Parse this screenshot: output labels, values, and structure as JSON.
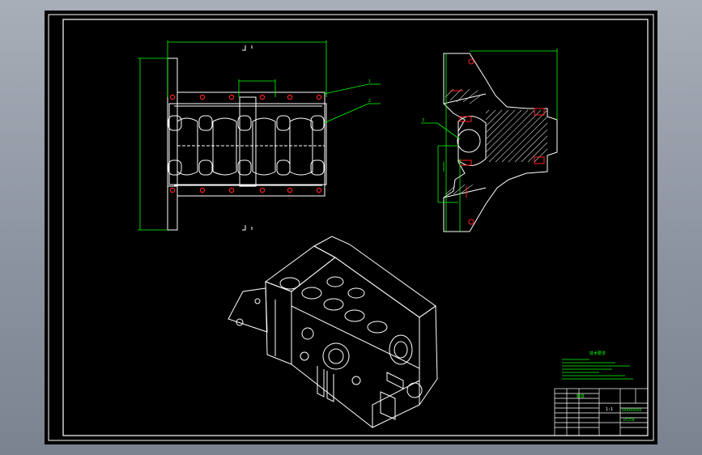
{
  "colors": {
    "paper": "#000000",
    "frame": "#ffffff",
    "dim": "#00ff00",
    "hidden": "#ff0000",
    "hatch": "#ffffff",
    "background": "#8f96a2"
  },
  "title_block": {
    "notes_heading": "技术要求",
    "scale": "1:1",
    "part_name": "缸体",
    "drawing_no": "XXXXXXXXX",
    "material": "HT250"
  },
  "callouts": {
    "front_view_labels": [
      "1",
      "2"
    ],
    "side_view_labels": [
      "3"
    ]
  },
  "views": [
    "front-view",
    "section-view",
    "isometric-view"
  ]
}
